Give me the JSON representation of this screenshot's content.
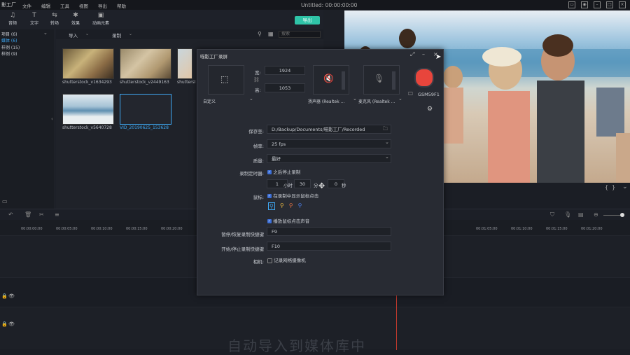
{
  "app": {
    "logo": "影工厂",
    "menu": [
      "文件",
      "编辑",
      "工具",
      "视图",
      "导出",
      "帮助"
    ],
    "title": "Untitled:",
    "timecode": "00:00:00:00"
  },
  "toolbar": {
    "items": [
      {
        "label": "音频",
        "icon": "♫"
      },
      {
        "label": "文字",
        "icon": "T"
      },
      {
        "label": "转场",
        "icon": "⇆"
      },
      {
        "label": "效果",
        "icon": "✱"
      },
      {
        "label": "动画元素",
        "icon": "▣"
      }
    ],
    "export_label": "导出"
  },
  "leftpane": {
    "items": [
      "项目 (6)",
      "媒体 (6)",
      "样例 (15)",
      "样例 (9)"
    ]
  },
  "media": {
    "import_label": "导入",
    "record_label": "录制",
    "search_placeholder": "搜索",
    "thumbs": [
      {
        "label": "shutterstock_v1634293"
      },
      {
        "label": "shutterstock_v2449163"
      },
      {
        "label": "shutterstock_v"
      },
      {
        "label": "shutterstock_v5640728"
      },
      {
        "label": "VID_20190625_153628"
      }
    ]
  },
  "dialog": {
    "title": "喵影工厂录屏",
    "width_label": "宽:",
    "width_value": "1924",
    "height_label": "高:",
    "height_value": "1053",
    "area_label": "自定义",
    "speaker_label": "扬声器 (Realtek ...",
    "mic_label": "麦克风 (Realtek ...",
    "monitor_label": "GSM59F1",
    "save_label": "保存至:",
    "save_path": "D:/Backup/Documents/喵影工厂/Recorded",
    "fps_label": "帧率:",
    "fps_value": "25 fps",
    "quality_label": "质量:",
    "quality_value": "最好",
    "timer_label": "录制定时器:",
    "timer_check": "之后停止录制",
    "hours_value": "1",
    "hours_unit": "小时",
    "minutes_value": "30",
    "minutes_unit": "分",
    "seconds_value": "0",
    "seconds_unit": "秒",
    "mouse_label": "鼠标:",
    "mouse_check": "在录制中显示鼠标点击",
    "sound_check": "播放鼠标点击声音",
    "pause_label": "暂停/恢复录制快捷键",
    "pause_value": "F9",
    "start_label": "开始/停止录制快捷键",
    "start_value": "F10",
    "camera_label": "相机:",
    "camera_check": "记录网络摄像机"
  },
  "timeline": {
    "ticks": [
      "00:00:00:00",
      "00:00:05:00",
      "00:00:10:00",
      "00:00:15:00",
      "00:00:20:00",
      "00:01:05:00",
      "00:01:10:00",
      "00:01:15:00",
      "00:01:20:00"
    ]
  },
  "subtitle": "自动导入到媒体库中",
  "colors": {
    "accent": "#2fc4a8",
    "record": "#e8453c",
    "checkbox": "#3c6fd8"
  }
}
